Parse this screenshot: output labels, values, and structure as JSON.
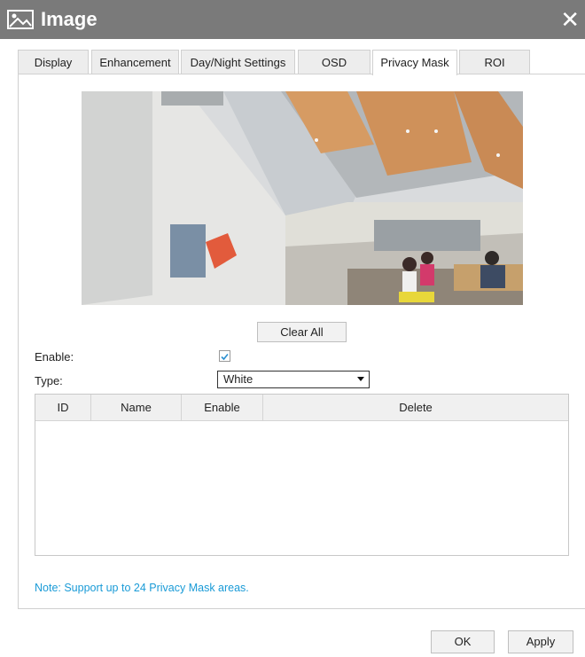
{
  "window": {
    "title": "Image",
    "icon": "image-icon",
    "close_icon": "close-icon",
    "close_label": "✕"
  },
  "tabs": [
    {
      "label": "Display",
      "active": false
    },
    {
      "label": "Enhancement",
      "active": false
    },
    {
      "label": "Day/Night Settings",
      "active": false
    },
    {
      "label": "OSD",
      "active": false
    },
    {
      "label": "Privacy Mask",
      "active": true
    },
    {
      "label": "ROI",
      "active": false
    }
  ],
  "privacy_mask": {
    "clear_all_label": "Clear All",
    "enable_label": "Enable:",
    "enable_checked": true,
    "type_label": "Type:",
    "type_value": "White",
    "table": {
      "columns": [
        "ID",
        "Name",
        "Enable",
        "Delete"
      ],
      "rows": []
    },
    "note": "Note: Support up to 24 Privacy Mask areas."
  },
  "footer": {
    "ok_label": "OK",
    "apply_label": "Apply"
  },
  "colors": {
    "title_bar": "#7a7a7a",
    "note_text": "#1a9bd7",
    "checkmark": "#2a8fd0"
  }
}
